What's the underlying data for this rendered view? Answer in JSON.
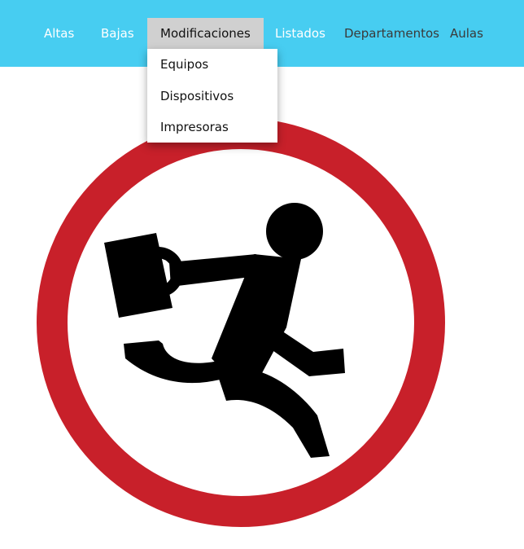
{
  "nav": {
    "items": [
      {
        "label": "Altas"
      },
      {
        "label": "Bajas"
      },
      {
        "label": "Modificaciones"
      },
      {
        "label": "Listados"
      },
      {
        "label": "Departamentos"
      },
      {
        "label": "Aulas"
      }
    ]
  },
  "dropdown": {
    "items": [
      {
        "label": "Equipos"
      },
      {
        "label": "Dispositivos"
      },
      {
        "label": "Impresoras"
      }
    ]
  },
  "colors": {
    "navbar": "#47cdf1",
    "active_item": "#d0d0d0",
    "sign_ring": "#c8202a",
    "figure": "#000000"
  },
  "illustration": {
    "icon": "no-running-sign-icon"
  }
}
